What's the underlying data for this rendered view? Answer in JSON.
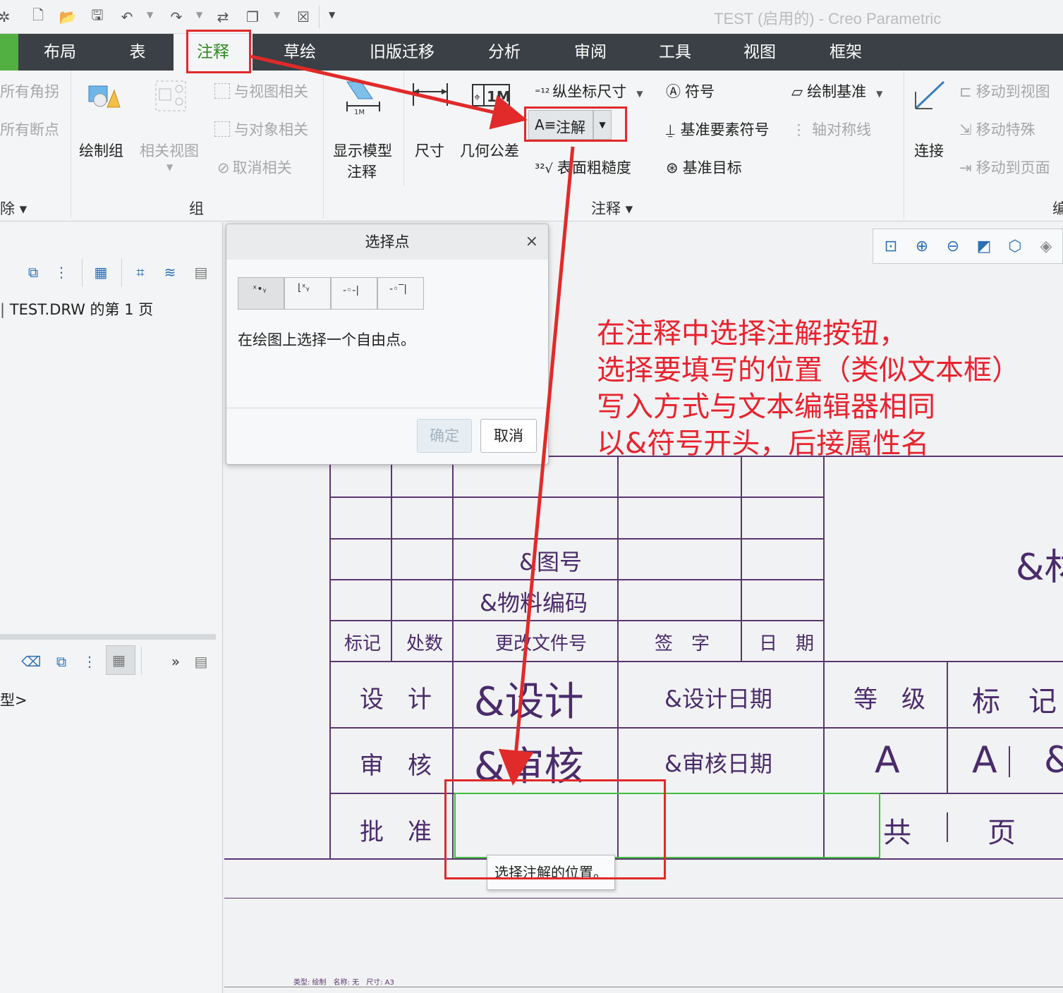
{
  "window_title": "TEST (启用的) - Creo Parametric",
  "tabs": [
    "布局",
    "表",
    "注释",
    "草绘",
    "旧版迁移",
    "分析",
    "审阅",
    "工具",
    "视图",
    "框架"
  ],
  "ribbon": {
    "left_partial": {
      "all_corners": "所有角拐",
      "all_breaks": "所有断点",
      "delete": "除"
    },
    "group_panel": {
      "draw_group": "绘制组",
      "related_view": "相关视图",
      "view_related": "与视图相关",
      "object_related": "与对象相关",
      "cancel_related": "取消相关",
      "label": "组"
    },
    "annotate": {
      "show_model_annotation_1": "显示模型",
      "show_model_annotation_2": "注释",
      "dimension": "尺寸",
      "gtol": "几何公差",
      "ordinate_dim": "纵坐标尺寸",
      "note": "注解",
      "surface_finish": "表面粗糙度",
      "symbol": "符号",
      "datum_feature_symbol": "基准要素符号",
      "datum_target": "基准目标",
      "draw_datum": "绘制基准",
      "axis_symmetry": "轴对称线",
      "label": "注释"
    },
    "edit": {
      "connect": "连接",
      "move_to_view": "移动到视图",
      "move_special": "移动特殊",
      "move_to_page": "移动到页面",
      "label_partial": "编"
    }
  },
  "left_panel": {
    "tree_item": "TEST.DRW 的第 1 页",
    "model_partial": "型>"
  },
  "dialog": {
    "title": "选择点",
    "message": "在绘图上选择一个自由点。",
    "ok": "确定",
    "cancel": "取消"
  },
  "annotation": {
    "lines": [
      "在注释中选择注解按钮，",
      "选择要填写的位置（类似文本框）",
      "写入方式与文本编辑器相同",
      "以&符号开头，后接属性名"
    ]
  },
  "title_block": {
    "drawing_no": "&图号",
    "material_code": "&物料编码",
    "material_partial": "&材",
    "headers": [
      "标记",
      "处数",
      "更改文件号",
      "签　字",
      "日　期"
    ],
    "design": "设　计",
    "design_value": "&设计",
    "design_date": "&设计日期",
    "grade": "等　级",
    "mark": "标　记",
    "review": "审　核",
    "review_value": "&审核",
    "review_date": "&审核日期",
    "grade_value": "A",
    "mark_value": "A",
    "mark_value2": "&",
    "approve": "批　准",
    "total": "共",
    "page": "页"
  },
  "tooltip": "选择注解的位置。",
  "status_line": "类型: 绘制　名称: 无　尺寸: A3",
  "colors": {
    "accent_green": "#52b043",
    "tab_bg": "#3a4045",
    "annotation_red": "#e8232f",
    "table_line": "#5a3670"
  }
}
